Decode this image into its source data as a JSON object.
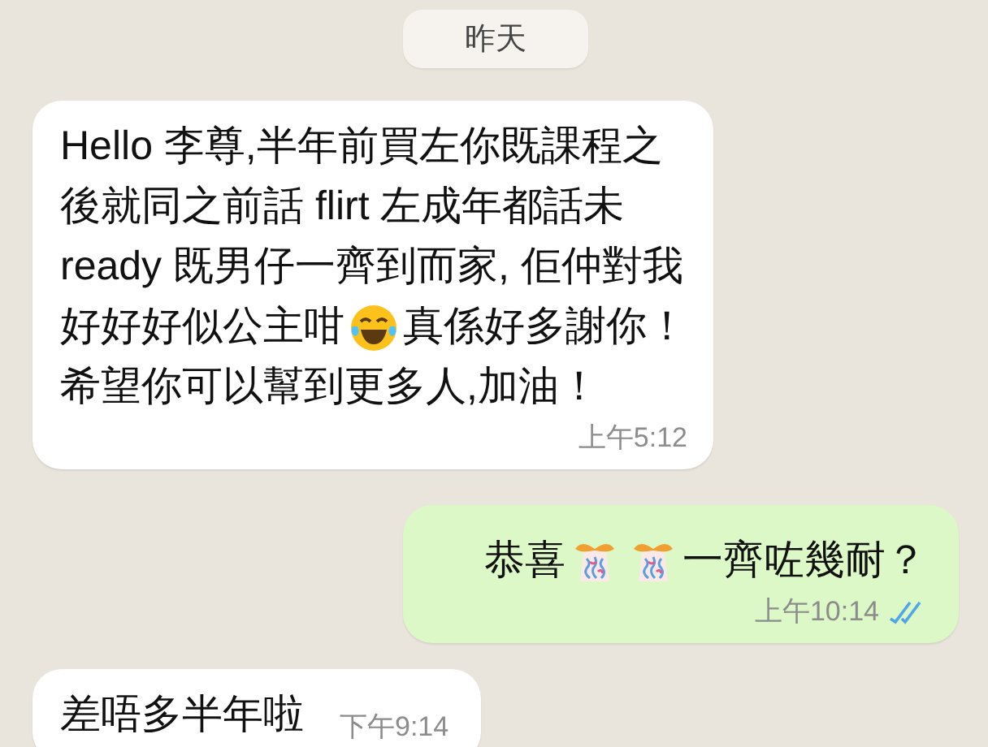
{
  "date_chip": "昨天",
  "messages": [
    {
      "kind": "incoming",
      "time": "上午5:12",
      "lines": [
        {
          "segments": [
            {
              "kind": "text",
              "text": "Hello 李尊,半年前買左你既課程之"
            }
          ]
        },
        {
          "segments": [
            {
              "kind": "text",
              "text": "後就同之前話 flirt 左成年都話未"
            }
          ]
        },
        {
          "segments": [
            {
              "kind": "text",
              "text": "ready 既男仔一齊到而家, 佢仲對我"
            }
          ]
        },
        {
          "segments": [
            {
              "kind": "text",
              "text": "好好好似公主咁"
            },
            {
              "kind": "laughing"
            },
            {
              "kind": "text",
              "text": "真係好多謝你！"
            }
          ]
        },
        {
          "segments": [
            {
              "kind": "text",
              "text": "希望你可以幫到更多人,加油！"
            }
          ]
        }
      ]
    },
    {
      "kind": "outgoing",
      "time": "上午10:14",
      "read": true,
      "lines": [
        {
          "segments": [
            {
              "kind": "text",
              "text": "恭喜"
            },
            {
              "kind": "party"
            },
            {
              "kind": "party"
            },
            {
              "kind": "text",
              "text": " 一齊咗幾耐？"
            }
          ]
        }
      ]
    },
    {
      "kind": "incoming",
      "time": "下午9:14",
      "inline_time": true,
      "lines": [
        {
          "segments": [
            {
              "kind": "text",
              "text": "差唔多半年啦"
            }
          ]
        }
      ]
    }
  ]
}
